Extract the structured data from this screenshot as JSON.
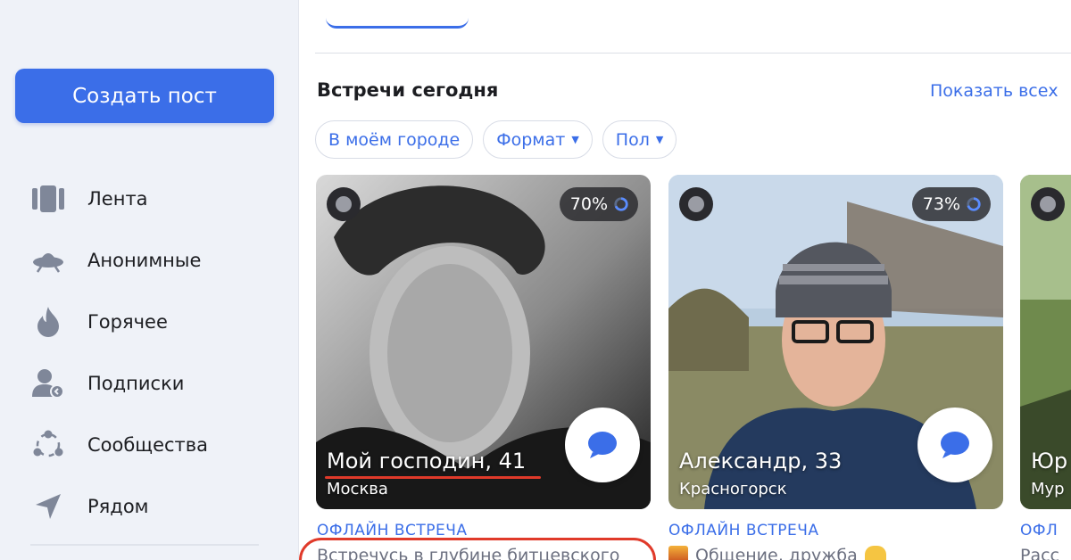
{
  "sidebar": {
    "create_post_label": "Создать пост",
    "items": [
      {
        "label": "Лента",
        "icon": "feed-icon"
      },
      {
        "label": "Анонимные",
        "icon": "ufo-icon"
      },
      {
        "label": "Горячее",
        "icon": "flame-icon"
      },
      {
        "label": "Подписки",
        "icon": "subscriptions-icon"
      },
      {
        "label": "Сообщества",
        "icon": "communities-icon"
      },
      {
        "label": "Рядом",
        "icon": "location-arrow-icon"
      }
    ]
  },
  "main": {
    "section_title": "Встречи сегодня",
    "show_all": "Показать всех",
    "filters": [
      {
        "label": "В моём городе"
      },
      {
        "label": "Формат"
      },
      {
        "label": "Пол"
      }
    ],
    "cards": [
      {
        "match": "70%",
        "name": "Мой господин, 41",
        "city": "Москва",
        "type": "ОФЛАЙН ВСТРЕЧА",
        "desc": "Встречусь в глубине битцевского"
      },
      {
        "match": "73%",
        "name": "Александр, 33",
        "city": "Красногорск",
        "type": "ОФЛАЙН ВСТРЕЧА",
        "desc": "Общение, дружба"
      },
      {
        "name": "Юр",
        "city": "Мур",
        "type": "ОФЛ",
        "desc": "Расс"
      }
    ]
  },
  "colors": {
    "accent": "#3b6ee8",
    "sidebar_bg": "#eff2f8",
    "annotation_red": "#e03a2a"
  }
}
